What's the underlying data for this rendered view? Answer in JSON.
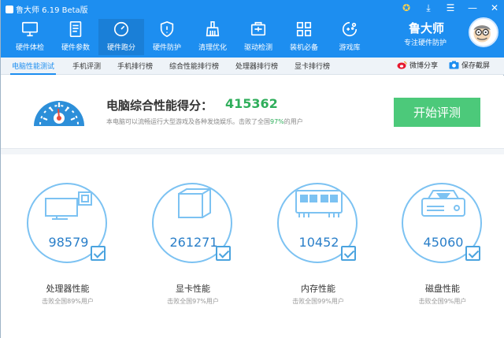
{
  "window": {
    "title": "鲁大师 6.19 Beta版",
    "controls": [
      "medal-icon",
      "download-icon",
      "menu-icon",
      "minimize-icon",
      "close-icon"
    ]
  },
  "toolbar": {
    "items": [
      {
        "label": "硬件体检",
        "icon": "monitor-icon"
      },
      {
        "label": "硬件参数",
        "icon": "document-icon"
      },
      {
        "label": "硬件跑分",
        "icon": "speedometer-icon",
        "active": true
      },
      {
        "label": "硬件防护",
        "icon": "shield-icon"
      },
      {
        "label": "清理优化",
        "icon": "broom-icon"
      },
      {
        "label": "驱动检测",
        "icon": "driver-icon"
      },
      {
        "label": "装机必备",
        "icon": "apps-grid-icon"
      },
      {
        "label": "游戏库",
        "icon": "gamepad-icon"
      }
    ]
  },
  "brand": {
    "name": "鲁大师",
    "slogan": "专注硬件防护"
  },
  "subtabs": {
    "items": [
      "电脑性能测试",
      "手机评测",
      "手机排行榜",
      "综合性能排行榜",
      "处理器排行榜",
      "显卡排行榜"
    ],
    "active": 0,
    "share_label": "微博分享",
    "screenshot_label": "保存截屏"
  },
  "score": {
    "title": "电脑综合性能得分：",
    "value": "415362",
    "desc_before": "本电脑可以流畅运行大型游戏及各种发烧娱乐。击败了全国",
    "desc_pct": "97%",
    "desc_after": "的用户",
    "start_button": "开始评测"
  },
  "cards": [
    {
      "score": "98579",
      "label": "处理器性能",
      "sub": "击败全国89%用户",
      "icon": "cpu-monitor-icon"
    },
    {
      "score": "261271",
      "label": "显卡性能",
      "sub": "击败全国97%用户",
      "icon": "graphics-cube-icon"
    },
    {
      "score": "10452",
      "label": "内存性能",
      "sub": "击败全国99%用户",
      "icon": "memory-chip-icon"
    },
    {
      "score": "45060",
      "label": "磁盘性能",
      "sub": "击败全国9%用户",
      "icon": "disk-drive-icon"
    }
  ],
  "colors": {
    "toolbar_blue": "#1d8ef0",
    "score_green": "#2fae5b",
    "button_green": "#4cc97a",
    "ring_blue": "#7cc2f2"
  }
}
